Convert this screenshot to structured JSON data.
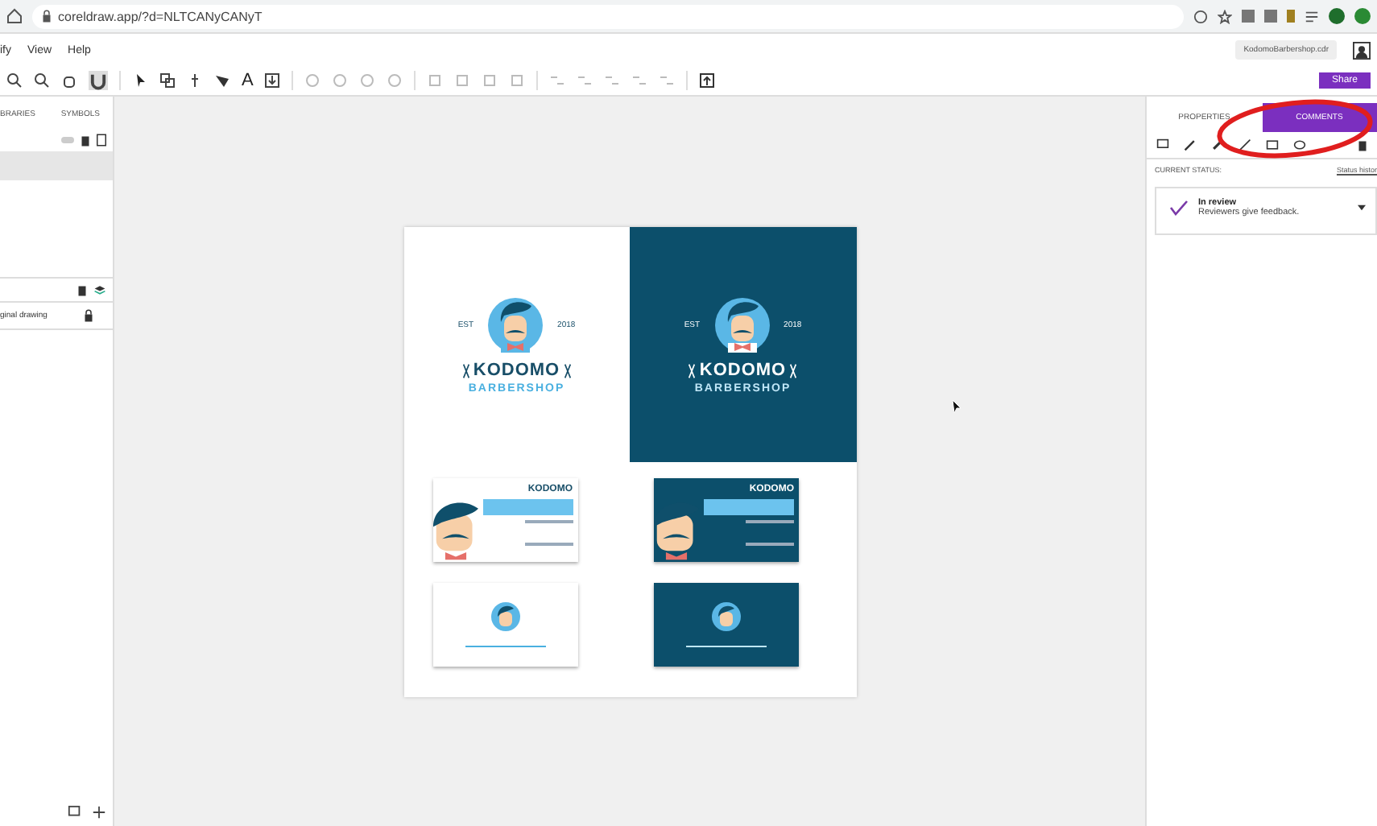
{
  "browser": {
    "url": "coreldraw.app/?d=NLTCANyCANyT"
  },
  "menu": [
    "ify",
    "View",
    "Help"
  ],
  "file_chip": {
    "name": "KodomoBarbershop.cdr"
  },
  "toolbar": {
    "text_tool": "A"
  },
  "share_button": {
    "label": "Share"
  },
  "left_panel": {
    "tabs": [
      {
        "label": "BRARIES",
        "selected": false
      },
      {
        "label": "SYMBOLS",
        "selected": false
      }
    ],
    "layer": "ginal drawing"
  },
  "right_panel": {
    "tabs": [
      {
        "label": "PROPERTIES",
        "selected": false
      },
      {
        "label": "COMMENTS",
        "selected": true
      }
    ],
    "status_label": "CURRENT STATUS:",
    "status_link": "Status histor",
    "status": {
      "title": "In review",
      "description": "Reviewers give feedback."
    }
  },
  "logos": [
    {
      "dark": false,
      "est": "EST",
      "year": "2018",
      "name": "KODOMO",
      "sub": "BARBERSHOP"
    },
    {
      "dark": true,
      "est": "EST",
      "year": "2018",
      "name": "KODOMO",
      "sub": "BARBERSHOP"
    }
  ],
  "cards": [
    {
      "dark": false,
      "kind": "front",
      "name": "KODOMO"
    },
    {
      "dark": true,
      "kind": "front",
      "name": "KODOMO"
    },
    {
      "dark": false,
      "kind": "back"
    },
    {
      "dark": true,
      "kind": "back"
    }
  ]
}
